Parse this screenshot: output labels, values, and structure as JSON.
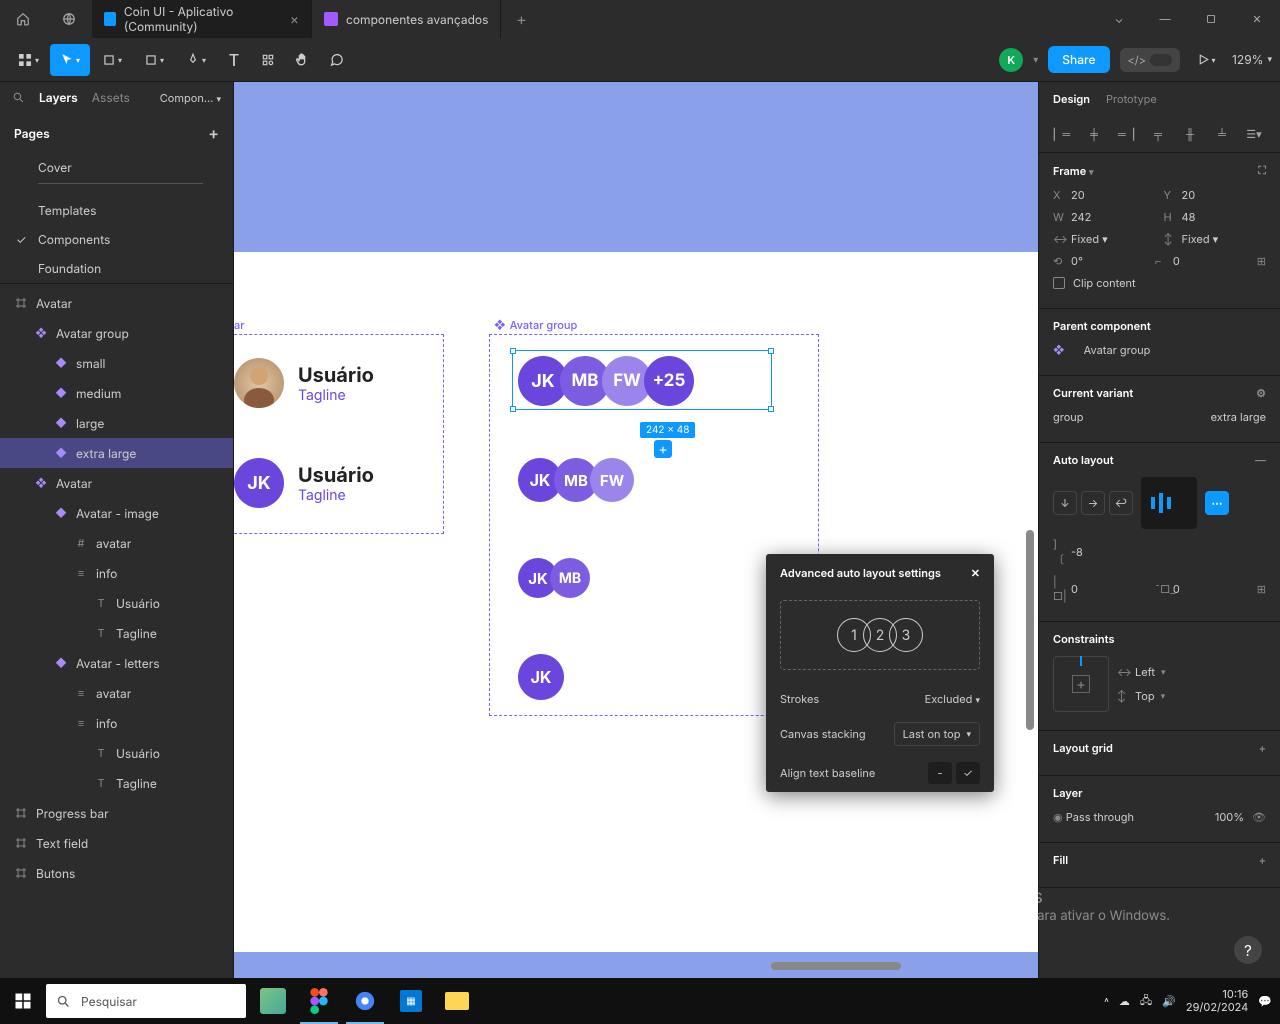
{
  "titlebar": {
    "tabs": [
      {
        "label": "Coin UI - Aplicativo (Community)",
        "active": true
      },
      {
        "label": "componentes avançados",
        "active": false
      }
    ]
  },
  "toolbar": {
    "user_initial": "K",
    "share_label": "Share",
    "zoom": "129%"
  },
  "left_panel": {
    "tabs": {
      "layers": "Layers",
      "assets": "Assets",
      "pagedrop": "Compon..."
    },
    "pages_label": "Pages",
    "pages": [
      "Cover",
      "Templates",
      "Components",
      "Foundation"
    ],
    "active_page_index": 2,
    "layers": [
      {
        "label": "Avatar",
        "icon": "frame",
        "indent": 0
      },
      {
        "label": "Avatar group",
        "icon": "diamond4",
        "indent": 1
      },
      {
        "label": "small",
        "icon": "diamond",
        "indent": 2
      },
      {
        "label": "medium",
        "icon": "diamond",
        "indent": 2
      },
      {
        "label": "large",
        "icon": "diamond",
        "indent": 2
      },
      {
        "label": "extra large",
        "icon": "diamond",
        "indent": 2,
        "selected": true
      },
      {
        "label": "Avatar",
        "icon": "diamond4",
        "indent": 1
      },
      {
        "label": "Avatar - image",
        "icon": "diamond",
        "indent": 2
      },
      {
        "label": "avatar",
        "icon": "grid",
        "indent": 3
      },
      {
        "label": "info",
        "icon": "lines",
        "indent": 3
      },
      {
        "label": "Usuário",
        "icon": "text",
        "indent": 4
      },
      {
        "label": "Tagline",
        "icon": "text",
        "indent": 4
      },
      {
        "label": "Avatar - letters",
        "icon": "diamond",
        "indent": 2
      },
      {
        "label": "avatar",
        "icon": "lines",
        "indent": 3
      },
      {
        "label": "info",
        "icon": "lines",
        "indent": 3
      },
      {
        "label": "Usuário",
        "icon": "text",
        "indent": 4
      },
      {
        "label": "Tagline",
        "icon": "text",
        "indent": 4
      },
      {
        "label": "Progress bar",
        "icon": "frame",
        "indent": 0
      },
      {
        "label": "Text field",
        "icon": "frame",
        "indent": 0
      },
      {
        "label": "Butons",
        "icon": "frame",
        "indent": 0
      }
    ]
  },
  "canvas": {
    "frame1_label": "ar",
    "frame2_label": "Avatar group",
    "user_label": "Usuário",
    "tagline_label": "Tagline",
    "avatars": {
      "a1": "JK",
      "a2": "MB",
      "a3": "FW",
      "a4": "+25"
    },
    "dim_badge": "242 × 48"
  },
  "auto_layout_popup": {
    "title": "Advanced auto layout settings",
    "preview_nums": [
      "1",
      "2",
      "3"
    ],
    "rows": {
      "strokes_label": "Strokes",
      "strokes_value": "Excluded",
      "stacking_label": "Canvas stacking",
      "stacking_value": "Last on top",
      "baseline_label": "Align text baseline"
    }
  },
  "right_panel": {
    "tabs": {
      "design": "Design",
      "prototype": "Prototype"
    },
    "frame": {
      "title": "Frame",
      "x_label": "X",
      "x": "20",
      "y_label": "Y",
      "y": "20",
      "w_label": "W",
      "w": "242",
      "h_label": "H",
      "h": "48",
      "w_mode": "Fixed",
      "h_mode": "Fixed",
      "rotation": "0°",
      "radius": "0",
      "clip_label": "Clip content"
    },
    "parent": {
      "title": "Parent component",
      "value": "Avatar group"
    },
    "variant": {
      "title": "Current variant",
      "prop": "group",
      "value": "extra large"
    },
    "autolayout": {
      "title": "Auto layout",
      "gap": "-8",
      "pad": "0",
      "pad2": "0"
    },
    "constraints": {
      "title": "Constraints",
      "h": "Left",
      "v": "Top"
    },
    "layout_grid": {
      "title": "Layout grid"
    },
    "layer": {
      "title": "Layer",
      "blend": "Pass through",
      "opacity": "100%"
    },
    "fill": {
      "title": "Fill"
    }
  },
  "watermark": {
    "line1": "Ativar o Windows",
    "line2": "Acesse Configurações para ativar o Windows."
  },
  "taskbar": {
    "search_placeholder": "Pesquisar",
    "time": "10:16",
    "date": "29/02/2024"
  }
}
